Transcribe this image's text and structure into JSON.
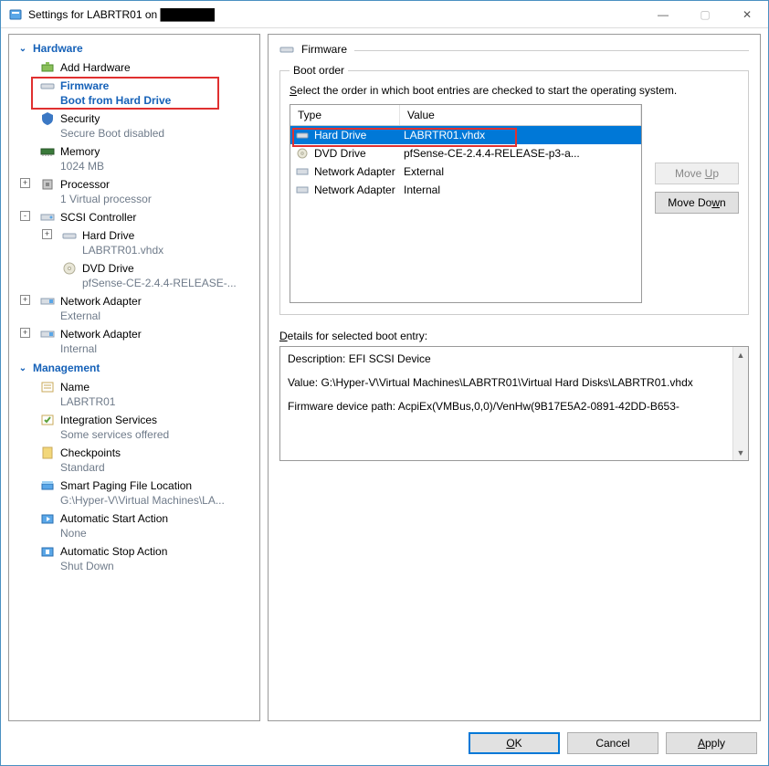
{
  "window": {
    "title": "Settings for LABRTR01 on ███████",
    "controls": {
      "min": "—",
      "max": "▢",
      "close": "✕"
    }
  },
  "sidebar": {
    "sections": {
      "hardware": "Hardware",
      "management": "Management"
    },
    "hardware": [
      {
        "label": "Add Hardware",
        "sub": ""
      },
      {
        "label": "Firmware",
        "sub": "Boot from Hard Drive",
        "selected": true
      },
      {
        "label": "Security",
        "sub": "Secure Boot disabled"
      },
      {
        "label": "Memory",
        "sub": "1024 MB"
      },
      {
        "label": "Processor",
        "sub": "1 Virtual processor",
        "expander": "+"
      },
      {
        "label": "SCSI Controller",
        "sub": "",
        "expander": "-"
      },
      {
        "label": "Hard Drive",
        "sub": "LABRTR01.vhdx",
        "level": 1,
        "expander": "+"
      },
      {
        "label": "DVD Drive",
        "sub": "pfSense-CE-2.4.4-RELEASE-...",
        "level": 1
      },
      {
        "label": "Network Adapter",
        "sub": "External",
        "expander": "+"
      },
      {
        "label": "Network Adapter",
        "sub": "Internal",
        "expander": "+"
      }
    ],
    "management": [
      {
        "label": "Name",
        "sub": "LABRTR01"
      },
      {
        "label": "Integration Services",
        "sub": "Some services offered"
      },
      {
        "label": "Checkpoints",
        "sub": "Standard"
      },
      {
        "label": "Smart Paging File Location",
        "sub": "G:\\Hyper-V\\Virtual Machines\\LA..."
      },
      {
        "label": "Automatic Start Action",
        "sub": "None"
      },
      {
        "label": "Automatic Stop Action",
        "sub": "Shut Down"
      }
    ]
  },
  "firmware": {
    "title": "Firmware",
    "boot_order": {
      "legend": "Boot order",
      "desc_pre": "S",
      "desc_rest": "elect the order in which boot entries are checked to start the operating system.",
      "columns": {
        "type": "Type",
        "value": "Value"
      },
      "rows": [
        {
          "type": "Hard Drive",
          "value": "LABRTR01.vhdx",
          "icon": "hdd",
          "selected": true
        },
        {
          "type": "DVD Drive",
          "value": "pfSense-CE-2.4.4-RELEASE-p3-a...",
          "icon": "dvd"
        },
        {
          "type": "Network Adapter",
          "value": "External",
          "icon": "nic"
        },
        {
          "type": "Network Adapter",
          "value": "Internal",
          "icon": "nic"
        }
      ],
      "move_up_pre": "Move ",
      "move_up_key": "U",
      "move_up_post": "p",
      "move_down_pre": "Move Do",
      "move_down_key": "w",
      "move_down_post": "n"
    },
    "details": {
      "label_pre": "D",
      "label_rest": "etails for selected boot entry:",
      "line1": "Description: EFI SCSI Device",
      "line2": "Value: G:\\Hyper-V\\Virtual Machines\\LABRTR01\\Virtual Hard Disks\\LABRTR01.vhdx",
      "line3": "Firmware device path: AcpiEx(VMBus,0,0)/VenHw(9B17E5A2-0891-42DD-B653-"
    }
  },
  "buttons": {
    "ok_key": "O",
    "ok_post": "K",
    "cancel": "Cancel",
    "apply_key": "A",
    "apply_post": "pply"
  }
}
